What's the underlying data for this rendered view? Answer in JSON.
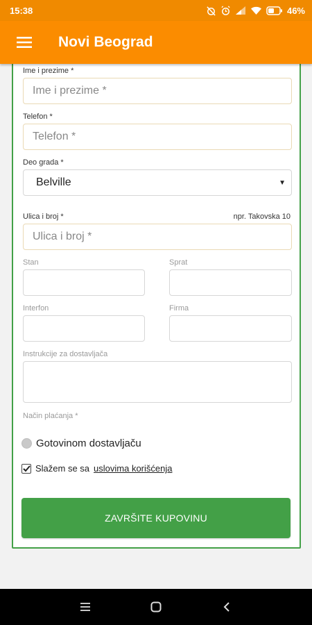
{
  "status_bar": {
    "time": "15:38",
    "battery": "46%"
  },
  "app_bar": {
    "title": "Novi Beograd",
    "menu_icon": "hamburger-menu-icon"
  },
  "form": {
    "full_name": {
      "label": "Ime i prezime *",
      "placeholder": "Ime i prezime *"
    },
    "phone": {
      "label": "Telefon *",
      "placeholder": "Telefon *"
    },
    "district": {
      "label": "Deo grada *",
      "value": "Belville"
    },
    "street": {
      "label": "Ulica i broj *",
      "hint": "npr. Takovska 10",
      "placeholder": "Ulica i broj *"
    },
    "apartment": {
      "label": "Stan"
    },
    "floor": {
      "label": "Sprat"
    },
    "intercom": {
      "label": "Interfon"
    },
    "company": {
      "label": "Firma"
    },
    "instructions": {
      "label": "Instrukcije za dostavljača"
    },
    "payment": {
      "label": "Način plaćanja *",
      "option": "Gotovinom dostavljaču"
    },
    "terms": {
      "text": "Slažem se sa ",
      "link": "uslovima korišćenja"
    },
    "submit_label": "ZAVRŠITE KUPOVINU"
  },
  "colors": {
    "status_bar": "#f08a00",
    "app_bar": "#fb8c00",
    "accent_green": "#43a047"
  }
}
